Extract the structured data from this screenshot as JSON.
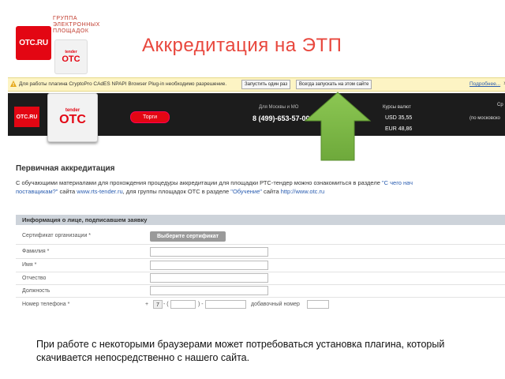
{
  "slide": {
    "logo_text": "ОТС.RU",
    "group_lines": [
      "ГРУППА",
      "ЭЛЕКТРОННЫХ",
      "ПЛОЩАДОК"
    ],
    "tender_logo_small": "tender",
    "tender_logo_big": "ОТС",
    "title": "Аккредитация на ЭТП",
    "caption": "При работе с некоторыми браузерами может потребоваться установка плагина, который скачивается непосредственно с нашего сайта."
  },
  "plugin_bar": {
    "message": "Для работы плагина CryptoPro CAdES NPAPI Browser Plug-in необходимо разрешение.",
    "run_once": "Запустить один раз",
    "always_run": "Всегда запускать на этом сайте",
    "more": "Подробнее...",
    "close": "×"
  },
  "site_header": {
    "logo_text": "ОТС.RU",
    "tender_small": "tender",
    "tender_big": "ОТС",
    "torgi": "Торги",
    "region_label": "Для Москвы и МО",
    "phone": "8 (499)-653-57-00",
    "currency_label": "Курсы валют",
    "usd": "USD 35,55",
    "eur": "EUR 48,86",
    "right_label": "Ср",
    "right_sub": "(по московско"
  },
  "form": {
    "title": "Первичная аккредитация",
    "desc_part1": "С обучающими материалами для прохождения процедуры аккредитации для площадки РТС-тендер можно ознакомиться в разделе ",
    "desc_link1": "\"С чего нач",
    "desc_part2_link": "поставщикам?\"",
    "desc_part3": " сайта ",
    "desc_link2": "www.rts-tender.ru",
    "desc_part4": ", для группы площадок ОТС в разделе ",
    "desc_link3": "\"Обучение\"",
    "desc_part5": " сайта ",
    "desc_link4": "http://www.otc.ru",
    "section_title": "Информация о лице, подписавшем заявку",
    "cert_label": "Сертификат организации *",
    "cert_button": "Выберите сертификат",
    "lastname_label": "Фамилия *",
    "firstname_label": "Имя *",
    "patronymic_label": "Отчество",
    "position_label": "Должность",
    "phone_label": "Номер телефона *",
    "phone_plus": "+",
    "phone_code": "7",
    "phone_dash1": "- (",
    "phone_dash2": ") -",
    "phone_ext": "добавочный номер"
  },
  "colors": {
    "brand_red": "#e30613",
    "title_red": "#e8473d",
    "arrow_green": "#7ab648",
    "link_blue": "#2a5db0"
  }
}
